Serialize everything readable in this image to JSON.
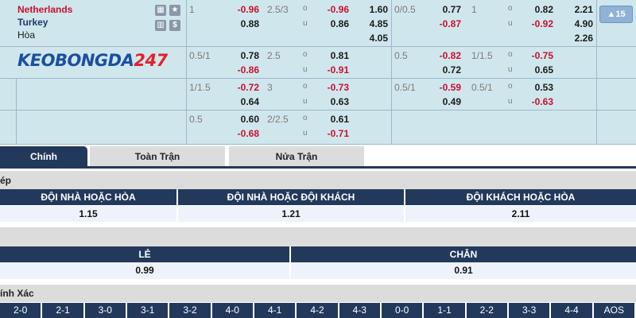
{
  "match": {
    "home_team": "Netherlands",
    "away_team": "Turkey",
    "draw_label": "Hòa",
    "more_badge": "▲15"
  },
  "logo": {
    "part1": "KEOBONGDA",
    "part2": "247"
  },
  "odds_rows": [
    {
      "hdp1": "1",
      "h1": "-0.96",
      "a1": "0.88",
      "ou1": "2.5/3",
      "o1": "-0.96",
      "u1": "0.86",
      "x1": [
        "1.60",
        "4.85",
        "4.05"
      ],
      "hdp2": "0/0.5",
      "h2": "0.77",
      "a2": "-0.87",
      "ou2": "1",
      "o2": "0.82",
      "u2": "-0.92",
      "x2": [
        "2.21",
        "4.90",
        "2.26"
      ]
    },
    {
      "hdp1": "0.5/1",
      "h1": "0.78",
      "a1": "-0.86",
      "ou1": "2.5",
      "o1": "0.81",
      "u1": "-0.91",
      "hdp2": "0.5",
      "h2": "-0.82",
      "a2": "0.72",
      "ou2": "1/1.5",
      "o2": "-0.75",
      "u2": "0.65"
    },
    {
      "hdp1": "1/1.5",
      "h1": "-0.72",
      "a1": "0.64",
      "ou1": "3",
      "o1": "-0.73",
      "u1": "0.63",
      "hdp2": "0.5/1",
      "h2": "-0.59",
      "a2": "0.49",
      "ou2": "0.5/1",
      "o2": "0.53",
      "u2": "-0.63"
    },
    {
      "hdp1": "0.5",
      "h1": "0.60",
      "a1": "-0.68",
      "ou1": "2/2.5",
      "o1": "0.61",
      "u1": "-0.71"
    }
  ],
  "ou_labels": {
    "over": "o",
    "under": "u"
  },
  "tabs": [
    "Chính",
    "Toàn Trận",
    "Nửa Trận"
  ],
  "double_chance": {
    "title": "ép",
    "headers": [
      "ĐỘI NHÀ HOẶC HÒA",
      "ĐỘI NHÀ HOẶC ĐỘI KHÁCH",
      "ĐỘI KHÁCH HOẶC HÒA"
    ],
    "values": [
      "1.15",
      "1.21",
      "2.11"
    ]
  },
  "odd_even": {
    "title": "",
    "headers": [
      "LẺ",
      "CHẴN"
    ],
    "values": [
      "0.99",
      "0.91"
    ]
  },
  "correct_score": {
    "title": "ính Xác",
    "scores": [
      "2-0",
      "2-1",
      "3-0",
      "3-1",
      "3-2",
      "4-0",
      "4-1",
      "4-2",
      "4-3",
      "0-0",
      "1-1",
      "2-2",
      "3-3",
      "4-4",
      "AOS"
    ]
  },
  "colors": {
    "odds_bg": "#cfe7ec",
    "header_navy": "#22395c",
    "negative_red": "#c8102e",
    "logo_blue": "#1b4fa0",
    "logo_red": "#e0222a"
  }
}
